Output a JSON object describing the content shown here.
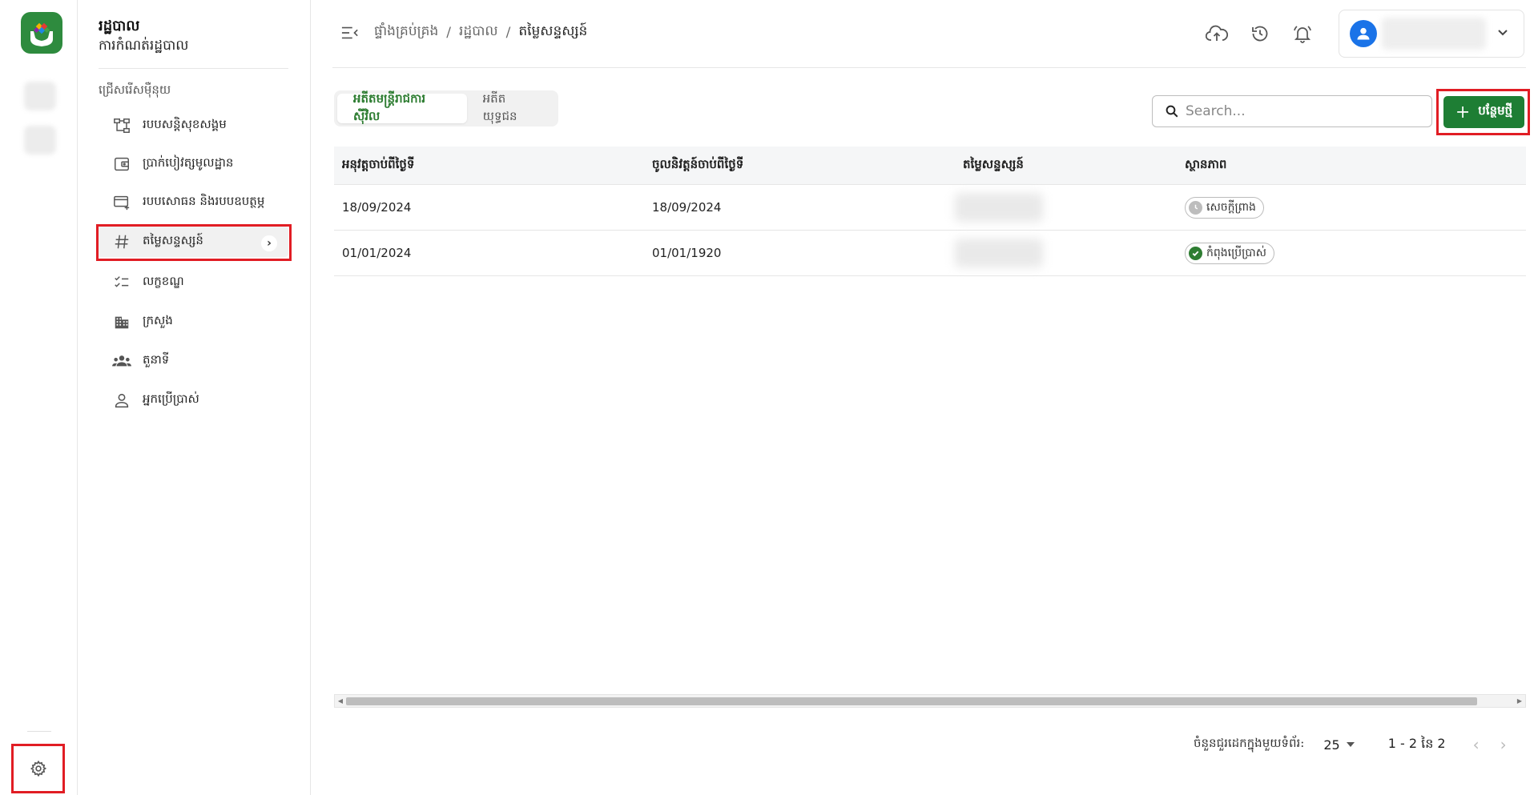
{
  "sidebar": {
    "title": "រដ្ឋបាល",
    "subtitle": "ការកំណត់រដ្ឋបាល",
    "section_label": "ជ្រើសរើសម៉ឺនុយ",
    "items": [
      {
        "label": "របបសន្តិសុខសង្គម",
        "icon": "schema-icon"
      },
      {
        "label": "ប្រាក់បៀវត្សមូលដ្ឋាន",
        "icon": "wallet-icon"
      },
      {
        "label": "របបសោធន និងរបបឧបត្ថម្ភ",
        "icon": "card-plus-icon"
      },
      {
        "label": "តម្លៃសន្ទស្សន៍",
        "icon": "hash-icon",
        "active": true
      },
      {
        "label": "លក្ខខណ្ឌ",
        "icon": "checklist-icon"
      },
      {
        "label": "ក្រសួង",
        "icon": "building-icon"
      },
      {
        "label": "តួនាទី",
        "icon": "group-icon"
      },
      {
        "label": "អ្នកប្រើប្រាស់",
        "icon": "user-icon"
      }
    ]
  },
  "breadcrumb": {
    "items": [
      "ផ្ទាំងគ្រប់គ្រង",
      "រដ្ឋបាល"
    ],
    "current": "តម្លៃសន្ទស្សន៍",
    "separator": "/"
  },
  "tabs": [
    {
      "label": "អតីតមន្ត្រីរាជការស៊ីវិល",
      "active": true
    },
    {
      "label": "អតីតយុទ្ធជន",
      "active": false
    }
  ],
  "search": {
    "placeholder": "Search..."
  },
  "add_button": {
    "label": "បន្ថែមថ្មី"
  },
  "table": {
    "columns": [
      "អនុវត្តចាប់ពីថ្ងៃទី",
      "ចូលនិវត្តន៍ចាប់ពីថ្ងៃទី",
      "តម្លៃសន្ទស្សន៍",
      "ស្ថានភាព"
    ],
    "rows": [
      {
        "apply_from": "18/09/2024",
        "retire_from": "18/09/2024",
        "status": "សេចក្តីព្រាង",
        "status_type": "draft"
      },
      {
        "apply_from": "01/01/2024",
        "retire_from": "01/01/1920",
        "status": "កំពុងប្រើប្រាស់",
        "status_type": "active"
      }
    ]
  },
  "pagination": {
    "rows_per_page_label": "ចំនួនជួរដេកក្នុងមួយទំព័រ:",
    "rows_per_page": "25",
    "range": "1 - 2 នៃ 2"
  },
  "colors": {
    "brand_green": "#1e7e34",
    "tab_active_text": "#2e7d32",
    "avatar_blue": "#1a73e8",
    "highlight_red": "#e11d24"
  }
}
